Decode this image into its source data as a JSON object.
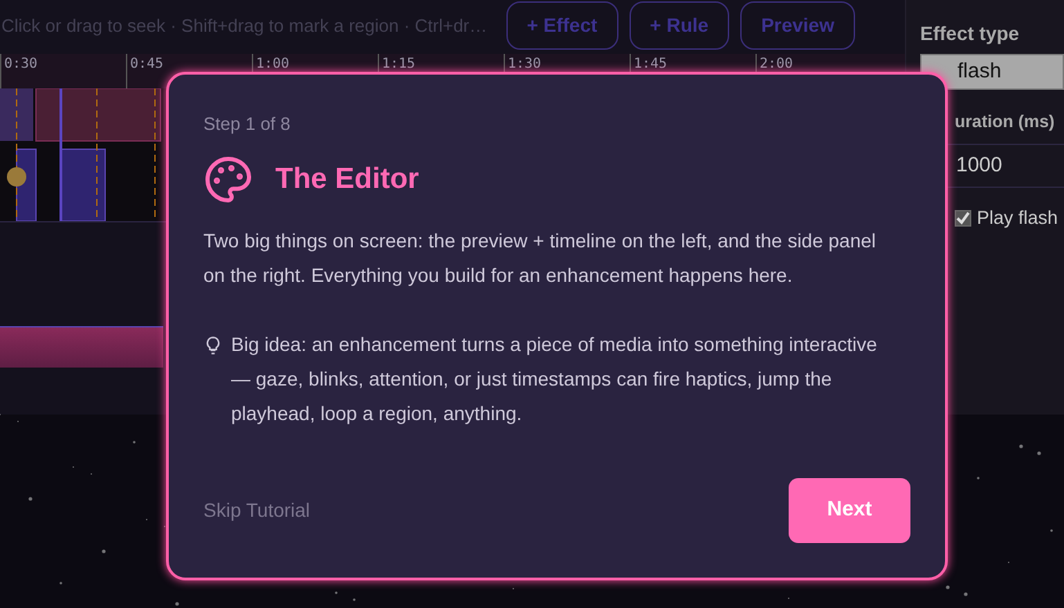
{
  "toolbar": {
    "hint": "Click or drag to seek · Shift+drag to mark a region · Ctrl+dr…",
    "buttons": [
      "+ Effect",
      "+ Rule",
      "Preview"
    ]
  },
  "timeline": {
    "ticks": [
      "0:30",
      "0:45",
      "1:00",
      "1:15",
      "1:30",
      "1:45",
      "2:00"
    ]
  },
  "side_panel": {
    "effect_type": {
      "label": "Effect type",
      "value": "flash"
    },
    "duration": {
      "label": "uration (ms)",
      "value": "1000"
    },
    "option": {
      "label": "Play flash",
      "checked": true
    }
  },
  "tutorial": {
    "step": "Step 1 of 8",
    "title": "The Editor",
    "paragraphs": [
      "Two big things on screen: the preview + timeline on the left, and the side panel on the right. Everything you build for an enhancement happens here.",
      "Big idea: an enhancement turns a piece of media into something interactive — gaze, blinks, attention, or just timestamps can fire haptics, jump the playhead, loop a region, anything."
    ],
    "skip": "Skip Tutorial",
    "next": "Next"
  }
}
